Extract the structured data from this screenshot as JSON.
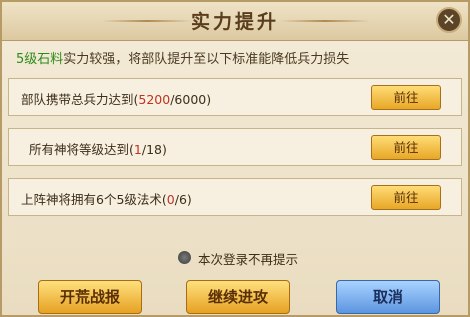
{
  "dialog": {
    "title": "实力提升",
    "intro_highlight": "5级石料",
    "intro_rest": "实力较强，将部队提升至以下标准能降低兵力损失"
  },
  "requirements": [
    {
      "text": "部队携带总兵力达到",
      "current": "5200",
      "target": "/6000",
      "button": "前往"
    },
    {
      "text": "所有神将等级达到",
      "current": "1",
      "target": "/18",
      "button": "前往"
    },
    {
      "text": "上阵神将拥有6个5级法术",
      "current": "0",
      "target": "/6",
      "button": "前往"
    }
  ],
  "footer": {
    "no_remind_label": "本次登录不再提示",
    "buttons": {
      "report": "开荒战报",
      "continue": "继续进攻",
      "cancel": "取消"
    }
  },
  "colors": {
    "highlight_green": "#2f8a1c",
    "progress_red": "#c0331f",
    "gold_button": "#e8a727",
    "blue_button": "#5c95e0"
  }
}
